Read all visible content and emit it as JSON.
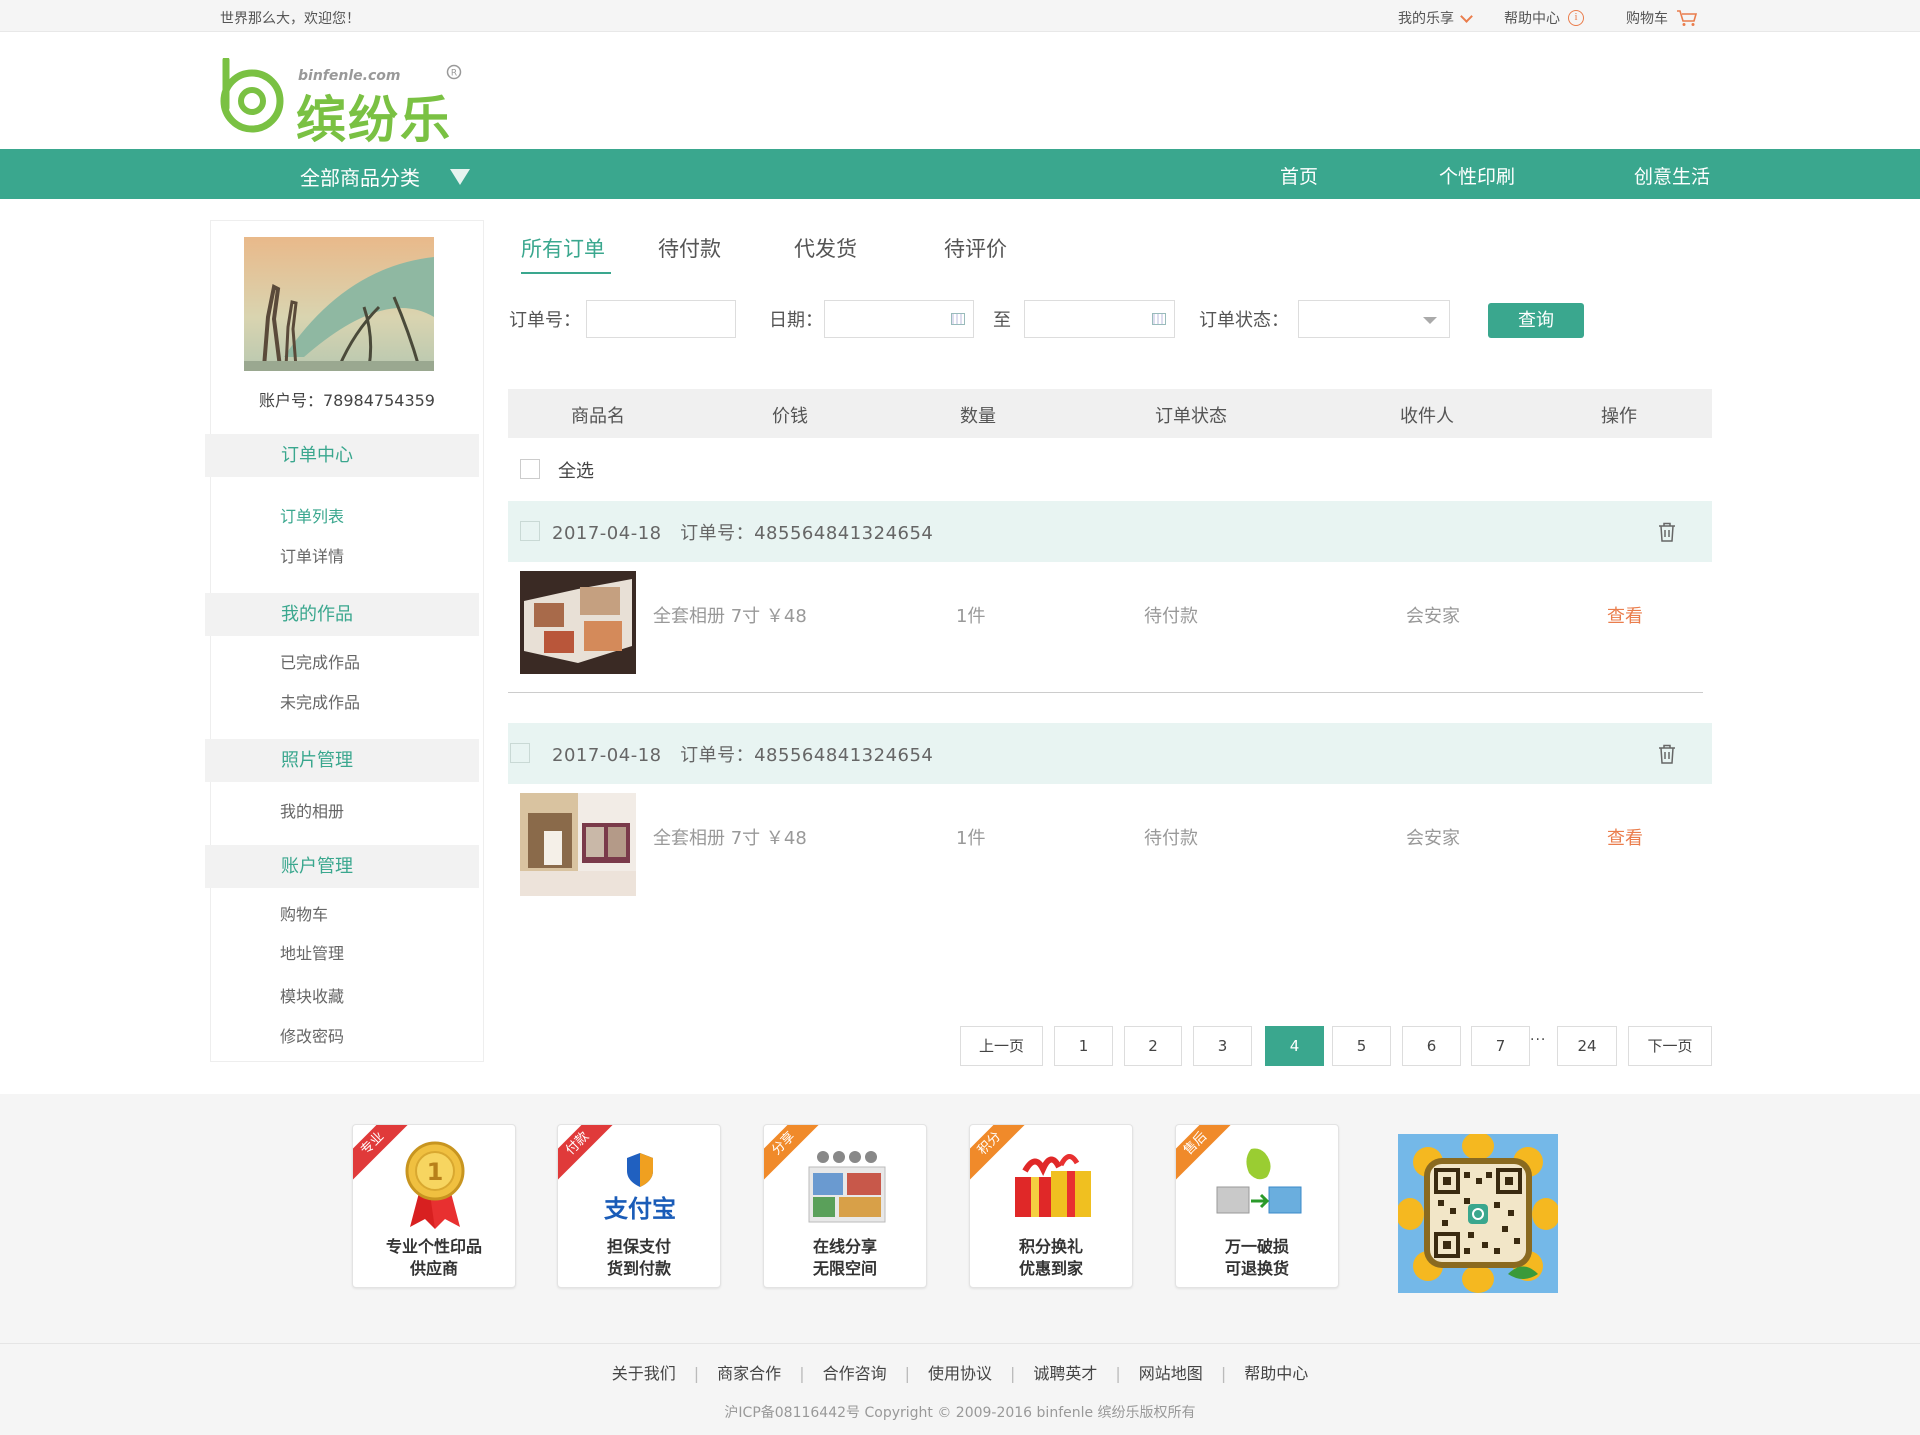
{
  "topbar": {
    "welcome": "世界那么大，欢迎您！",
    "my_lexiang": "我的乐享",
    "help_center": "帮助中心",
    "cart": "购物车"
  },
  "logo": {
    "url_text": "binfenle.com",
    "brand": "缤纷乐"
  },
  "nav": {
    "all_categories": "全部商品分类",
    "items": [
      "首页",
      "个性印刷",
      "创意生活"
    ]
  },
  "sidebar": {
    "account": "账户号：78984754359",
    "sections": [
      {
        "title": "订单中心",
        "links": [
          "订单列表",
          "订单详情"
        ]
      },
      {
        "title": "我的作品",
        "links": [
          "已完成作品",
          "未完成作品"
        ]
      },
      {
        "title": "照片管理",
        "links": [
          "我的相册"
        ]
      },
      {
        "title": "账户管理",
        "links": [
          "购物车",
          "地址管理",
          "模块收藏",
          "修改密码"
        ]
      }
    ]
  },
  "tabs": [
    "所有订单",
    "待付款",
    "代发货",
    "待评价"
  ],
  "filter": {
    "order_no_label": "订单号：",
    "date_label": "日期：",
    "to_label": "至",
    "status_label": "订单状态：",
    "query_button": "查询",
    "order_no_value": "",
    "date_from": "",
    "date_to": "",
    "status_value": ""
  },
  "table": {
    "headers": [
      "商品名",
      "价钱",
      "数量",
      "订单状态",
      "收件人",
      "操作"
    ],
    "select_all": "全选"
  },
  "orders": [
    {
      "header": "2017-04-18　订单号：485564841324654",
      "product": "全套相册 7寸 ￥48",
      "qty": "1件",
      "status": "待付款",
      "recipient": "会安家",
      "action": "查看"
    },
    {
      "header": "2017-04-18　订单号：485564841324654",
      "product": "全套相册 7寸 ￥48",
      "qty": "1件",
      "status": "待付款",
      "recipient": "会安家",
      "action": "查看"
    }
  ],
  "pagination": {
    "prev": "上一页",
    "pages": [
      "1",
      "2",
      "3",
      "4",
      "5",
      "6",
      "7"
    ],
    "dots": "···",
    "last": "24",
    "next": "下一页",
    "current": "4"
  },
  "features": [
    {
      "ribbon": "专业",
      "line1": "专业个性印品",
      "line2": "供应商"
    },
    {
      "ribbon": "付款",
      "line1": "担保支付",
      "line2": "货到付款"
    },
    {
      "ribbon": "分享",
      "line1": "在线分享",
      "line2": "无限空间"
    },
    {
      "ribbon": "积分",
      "line1": "积分换礼",
      "line2": "优惠到家"
    },
    {
      "ribbon": "售后",
      "line1": "万一破损",
      "line2": "可退换货"
    }
  ],
  "footer": {
    "links": [
      "关于我们",
      "商家合作",
      "合作咨询",
      "使用协议",
      "诚聘英才",
      "网站地图",
      "帮助中心"
    ],
    "copyright": "沪ICP备08116442号 Copyright © 2009-2016 binfenle 缤纷乐版权所有"
  },
  "colors": {
    "brand_green": "#3aa78e",
    "accent_orange": "#ea7d4c",
    "logo_green": "#7ac143"
  }
}
